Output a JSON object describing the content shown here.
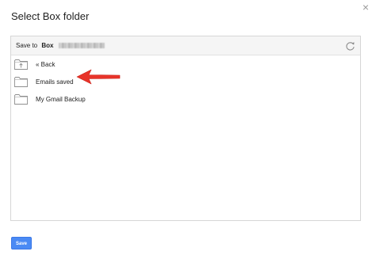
{
  "dialog": {
    "title": "Select Box folder",
    "close_glyph": "×"
  },
  "panel": {
    "header": {
      "save_to_label": "Save to",
      "service_name": "Box",
      "refresh_icon": "refresh-icon"
    },
    "folders": [
      {
        "label": "« Back",
        "icon": "folder-up-icon"
      },
      {
        "label": "Emails saved",
        "icon": "folder-icon"
      },
      {
        "label": "My Gmail Backup",
        "icon": "folder-icon"
      }
    ]
  },
  "annotation": {
    "arrow_color": "#e8342a"
  },
  "footer": {
    "save_label": "Save"
  },
  "colors": {
    "accent": "#4a8af4",
    "border": "#d6d6d6"
  }
}
